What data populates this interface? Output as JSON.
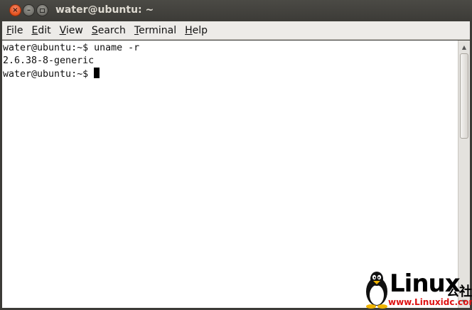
{
  "window": {
    "title": "water@ubuntu: ~",
    "controls": {
      "close": "×",
      "minimize": "–"
    }
  },
  "menubar": {
    "items": [
      {
        "mnemonic": "F",
        "rest": "ile"
      },
      {
        "mnemonic": "E",
        "rest": "dit"
      },
      {
        "mnemonic": "V",
        "rest": "iew"
      },
      {
        "mnemonic": "S",
        "rest": "earch"
      },
      {
        "mnemonic": "T",
        "rest": "erminal"
      },
      {
        "mnemonic": "H",
        "rest": "elp"
      }
    ]
  },
  "terminal": {
    "lines": [
      "water@ubuntu:~$ uname -r",
      "2.6.38-8-generic",
      "water@ubuntu:~$"
    ]
  },
  "scrollbar": {
    "up_arrow": "▲",
    "down_arrow": "▼"
  },
  "watermark": {
    "brand": "Linux",
    "cn": "公社",
    "url": "www.Linuxidc.com"
  },
  "colors": {
    "titlebar": "#3c3b37",
    "menubar": "#edebe8",
    "terminal_bg": "#ffffff",
    "close_button": "#e2501c",
    "watermark_url": "#dd1111"
  }
}
